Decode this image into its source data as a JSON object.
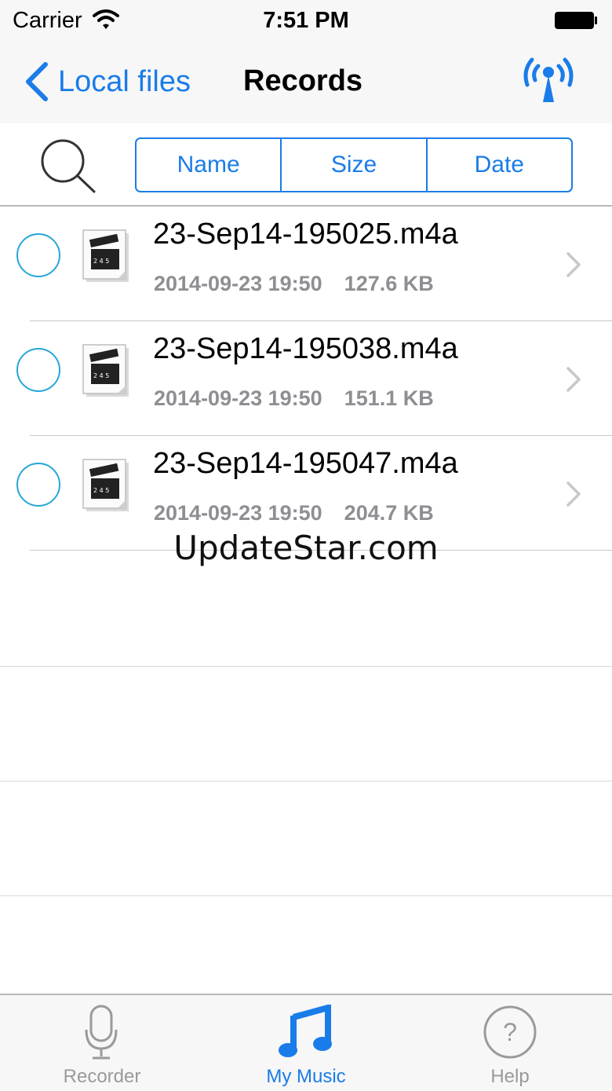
{
  "status_bar": {
    "carrier": "Carrier",
    "time": "7:51 PM"
  },
  "nav": {
    "back_label": "Local files",
    "title": "Records"
  },
  "sort": {
    "name": "Name",
    "size": "Size",
    "date": "Date"
  },
  "files": [
    {
      "name": "23-Sep14-195025.m4a",
      "date": "2014-09-23 19:50",
      "size": "127.6 KB"
    },
    {
      "name": "23-Sep14-195038.m4a",
      "date": "2014-09-23 19:50",
      "size": "151.1 KB"
    },
    {
      "name": "23-Sep14-195047.m4a",
      "date": "2014-09-23 19:50",
      "size": "204.7 KB"
    }
  ],
  "watermark": "UpdateStar.com",
  "tabs": {
    "recorder": "Recorder",
    "my_music": "My Music",
    "help": "Help"
  },
  "colors": {
    "accent": "#1a7ce8",
    "radio": "#27a6d8",
    "secondary_text": "#8e8e93"
  }
}
